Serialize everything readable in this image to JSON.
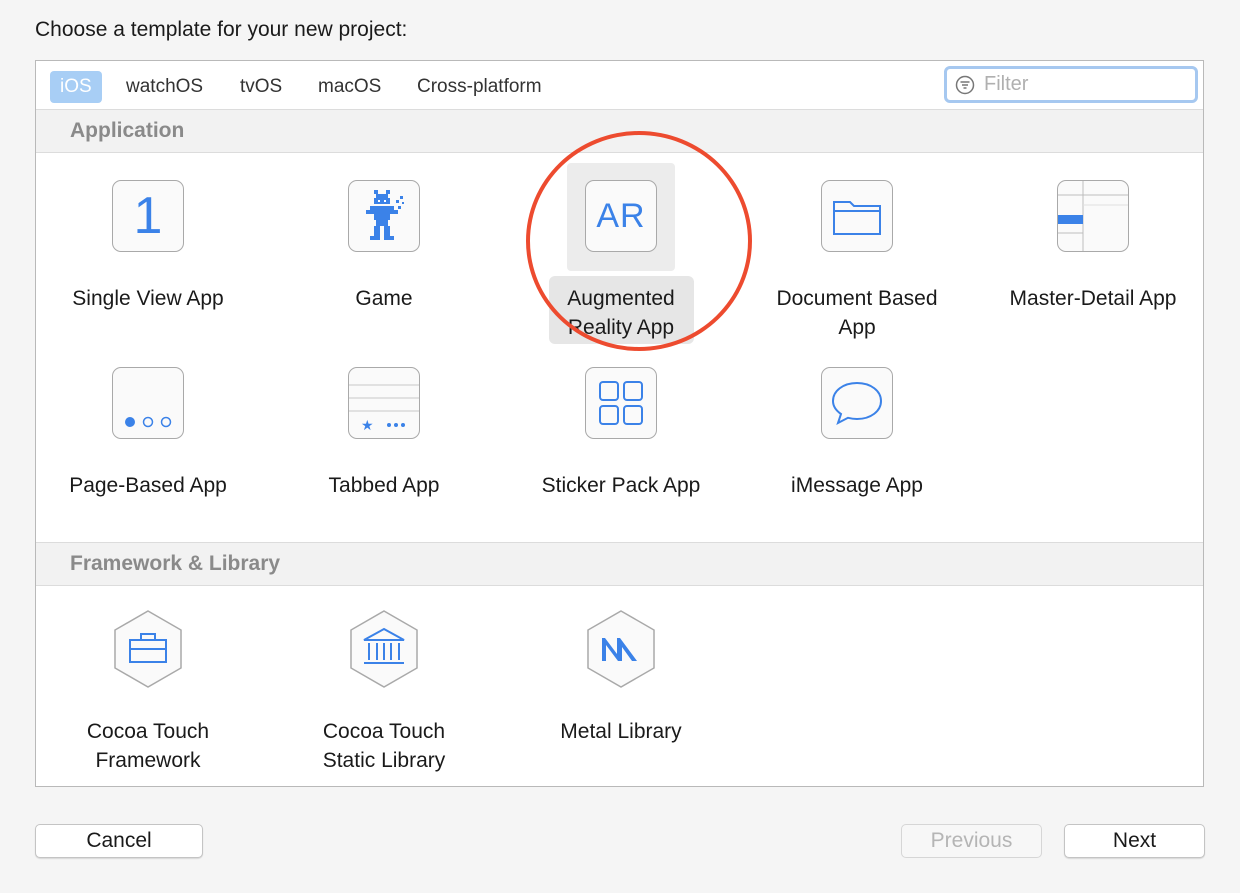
{
  "dialog": {
    "prompt": "Choose a template for your new project:"
  },
  "platform_tabs": [
    {
      "label": "iOS",
      "selected": true
    },
    {
      "label": "watchOS",
      "selected": false
    },
    {
      "label": "tvOS",
      "selected": false
    },
    {
      "label": "macOS",
      "selected": false
    },
    {
      "label": "Cross-platform",
      "selected": false
    }
  ],
  "filter": {
    "placeholder": "Filter",
    "value": ""
  },
  "sections": {
    "application": {
      "title": "Application",
      "templates": [
        {
          "label_line1": "Single View App",
          "label_line2": "",
          "icon": "single-view-icon"
        },
        {
          "label_line1": "Game",
          "label_line2": "",
          "icon": "game-icon"
        },
        {
          "label_line1": "Augmented",
          "label_line2": "Reality App",
          "icon": "ar-icon",
          "icon_text": "AR",
          "selected": true
        },
        {
          "label_line1": "Document Based",
          "label_line2": "App",
          "icon": "folder-icon"
        },
        {
          "label_line1": "Master-Detail App",
          "label_line2": "",
          "icon": "master-detail-icon"
        },
        {
          "label_line1": "Page-Based App",
          "label_line2": "",
          "icon": "page-based-icon"
        },
        {
          "label_line1": "Tabbed App",
          "label_line2": "",
          "icon": "tabbed-icon"
        },
        {
          "label_line1": "Sticker Pack App",
          "label_line2": "",
          "icon": "sticker-grid-icon"
        },
        {
          "label_line1": "iMessage App",
          "label_line2": "",
          "icon": "speech-bubble-icon"
        }
      ],
      "single_view_glyph": "1"
    },
    "framework": {
      "title": "Framework & Library",
      "templates": [
        {
          "label_line1": "Cocoa Touch",
          "label_line2": "Framework",
          "icon": "toolbox-icon"
        },
        {
          "label_line1": "Cocoa Touch",
          "label_line2": "Static Library",
          "icon": "library-building-icon"
        },
        {
          "label_line1": "Metal Library",
          "label_line2": "",
          "icon": "metal-icon"
        }
      ]
    }
  },
  "buttons": {
    "cancel": "Cancel",
    "previous": "Previous",
    "next": "Next"
  },
  "colors": {
    "accent": "#3b82e8",
    "selected_tab_bg": "#a8cef5",
    "annotation_circle": "#ed4b2f"
  }
}
